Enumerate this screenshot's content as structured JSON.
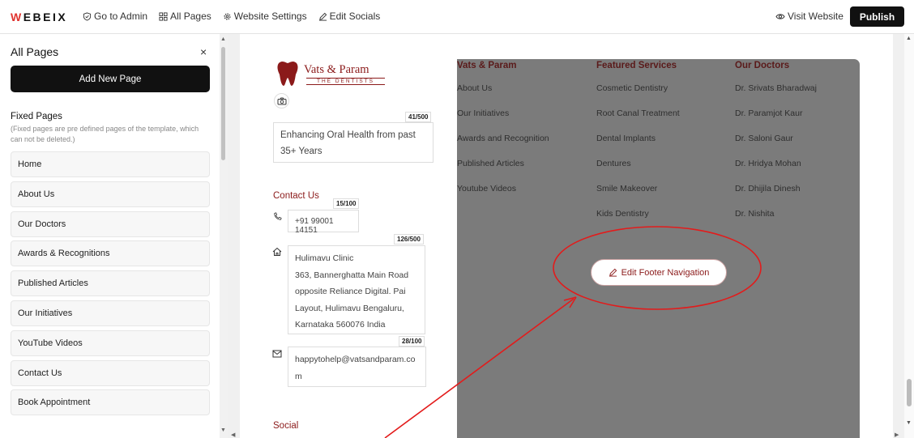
{
  "app": {
    "logo": "WEBEIX"
  },
  "topbar": {
    "nav": [
      {
        "label": "Go to Admin",
        "icon": "shield-icon"
      },
      {
        "label": "All Pages",
        "icon": "grid-icon"
      },
      {
        "label": "Website Settings",
        "icon": "gear-icon"
      },
      {
        "label": "Edit Socials",
        "icon": "pencil-icon"
      }
    ],
    "visit_label": "Visit Website",
    "publish_label": "Publish"
  },
  "sidebar": {
    "title": "All Pages",
    "close_icon": "×",
    "add_label": "Add New Page",
    "fixed_title": "Fixed Pages",
    "fixed_note": "(Fixed pages are pre defined pages of the template, which can not be deleted.)",
    "pages": [
      "Home",
      "About Us",
      "Our Doctors",
      "Awards & Recognitions",
      "Published Articles",
      "Our Initiatives",
      "YouTube Videos",
      "Contact Us",
      "Book Appointment"
    ]
  },
  "footer_editor": {
    "brand_name": "Vats & Param",
    "brand_sub": "THE DENTISTS",
    "tagline": {
      "counter": "41/500",
      "text": "Enhancing Oral Health from past 35+ Years"
    },
    "contact_title": "Contact Us",
    "phone": {
      "counter": "15/100",
      "value": "+91 99001 14151"
    },
    "address": {
      "counter": "126/500",
      "lines": [
        "Hulimavu Clinic",
        "363, Bannerghatta Main Road",
        "opposite Reliance Digital. Pai",
        "Layout, Hulimavu Bengaluru,",
        "Karnataka 560076 India"
      ]
    },
    "email": {
      "counter": "28/100",
      "value": "happytohelp@vatsandparam.com"
    },
    "social_title": "Social"
  },
  "footer_nav": {
    "columns": [
      {
        "heading": "Vats & Param",
        "links": [
          "About Us",
          "Our Initiatives",
          "Awards and Recognition",
          "Published Articles",
          "Youtube Videos"
        ]
      },
      {
        "heading": "Featured Services",
        "links": [
          "Cosmetic Dentistry",
          "Root Canal Treatment",
          "Dental Implants",
          "Dentures",
          "Smile Makeover",
          "Kids Dentistry"
        ]
      },
      {
        "heading": "Our Doctors",
        "links": [
          "Dr. Srivats Bharadwaj",
          "Dr. Paramjot Kaur",
          "Dr. Saloni Gaur",
          "Dr. Hridya Mohan",
          "Dr. Dhijila Dinesh",
          "Dr. Nishita"
        ]
      }
    ],
    "edit_label": "Edit Footer Navigation"
  },
  "colors": {
    "accent": "#8b1a1a",
    "annotation": "#e31b1b",
    "panel": "#7b7b7b"
  }
}
